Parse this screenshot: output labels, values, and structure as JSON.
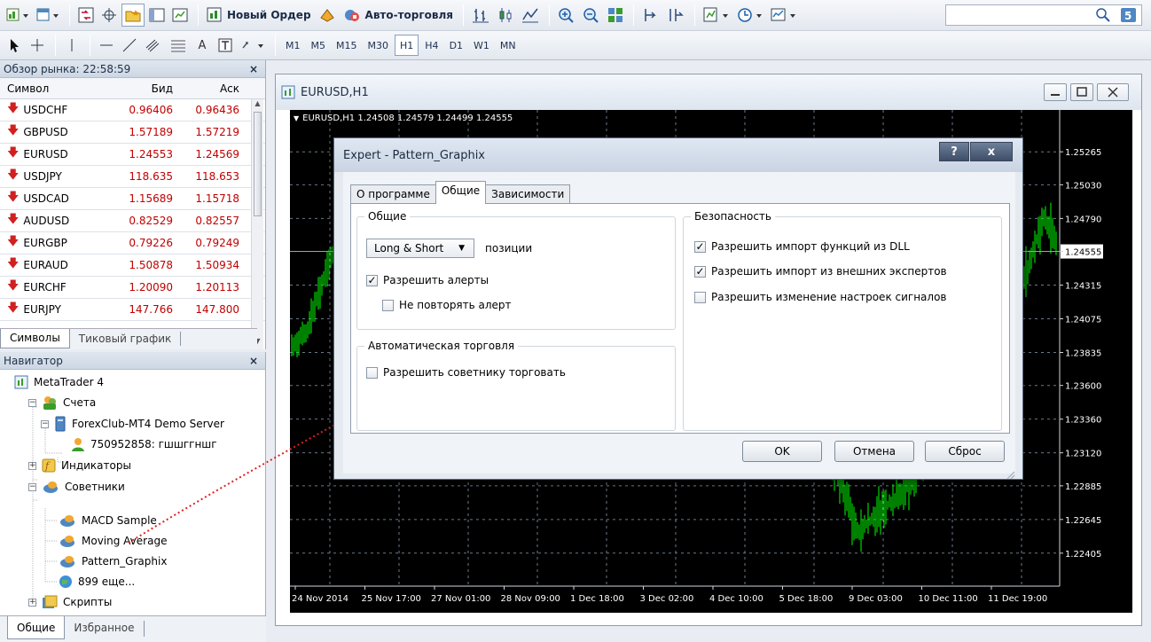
{
  "toolbar": {
    "new_order_label": "Новый Ордер",
    "auto_trading_label": "Авто-торговля",
    "timeframes": [
      "M1",
      "M5",
      "M15",
      "M30",
      "H1",
      "H4",
      "D1",
      "W1",
      "MN"
    ],
    "active_timeframe": "H1",
    "text_tool_label": "A"
  },
  "market_watch": {
    "title": "Обзор рынка: 22:58:59",
    "columns": {
      "symbol": "Символ",
      "bid": "Бид",
      "ask": "Аск"
    },
    "rows": [
      {
        "symbol": "USDCHF",
        "bid": "0.96406",
        "ask": "0.96436"
      },
      {
        "symbol": "GBPUSD",
        "bid": "1.57189",
        "ask": "1.57219"
      },
      {
        "symbol": "EURUSD",
        "bid": "1.24553",
        "ask": "1.24569"
      },
      {
        "symbol": "USDJPY",
        "bid": "118.635",
        "ask": "118.653"
      },
      {
        "symbol": "USDCAD",
        "bid": "1.15689",
        "ask": "1.15718"
      },
      {
        "symbol": "AUDUSD",
        "bid": "0.82529",
        "ask": "0.82557"
      },
      {
        "symbol": "EURGBP",
        "bid": "0.79226",
        "ask": "0.79249"
      },
      {
        "symbol": "EURAUD",
        "bid": "1.50878",
        "ask": "1.50934"
      },
      {
        "symbol": "EURCHF",
        "bid": "1.20090",
        "ask": "1.20113"
      },
      {
        "symbol": "EURJPY",
        "bid": "147.766",
        "ask": "147.800"
      }
    ],
    "tabs": [
      "Символы",
      "Тиковый график"
    ],
    "close": "×"
  },
  "navigator": {
    "title": "Навигатор",
    "close": "×",
    "root": "MetaTrader 4",
    "accounts": "Счета",
    "server": "ForexClub-MT4 Demo Server",
    "account": "750952858: гшшггншг",
    "indicators": "Индикаторы",
    "experts": "Советники",
    "expert_items": [
      "MACD Sample",
      "Moving Average",
      "Pattern_Graphix",
      "899 еще..."
    ],
    "scripts": "Скрипты",
    "tabs": [
      "Общие",
      "Избранное"
    ]
  },
  "chart": {
    "window_title": "EURUSD,H1",
    "info": "EURUSD,H1  1.24508 1.24579 1.24499 1.24555",
    "price_labels": [
      "1.25265",
      "1.25030",
      "1.24790",
      "1.24555",
      "1.24315",
      "1.24075",
      "1.23835",
      "1.23600",
      "1.23360",
      "1.23120",
      "1.22885",
      "1.22645",
      "1.22405"
    ],
    "current_price": "1.24555",
    "time_labels": [
      "24 Nov 2014",
      "25 Nov 17:00",
      "27 Nov 01:00",
      "28 Nov 09:00",
      "1 Dec 18:00",
      "3 Dec 02:00",
      "4 Dec 10:00",
      "5 Dec 18:00",
      "9 Dec 03:00",
      "10 Dec 11:00",
      "11 Dec 19:00"
    ],
    "colors": {
      "background": "#000000",
      "candles": "#00ff00",
      "grid": "#6b7a8a"
    }
  },
  "dialog": {
    "title": "Expert - Pattern_Graphix",
    "help": "?",
    "close": "x",
    "tabs": [
      "О программе",
      "Общие",
      "Зависимости"
    ],
    "active_tab": "Общие",
    "general_group": "Общие",
    "positions_select": "Long & Short",
    "positions_label": "позиции",
    "allow_alerts": "Разрешить алерты",
    "no_repeat_alert": "Не повторять алерт",
    "auto_trading_group": "Автоматическая торговля",
    "allow_expert_trade": "Разрешить советнику торговать",
    "security_group": "Безопасность",
    "allow_dll": "Разрешить импорт функций из DLL",
    "allow_external": "Разрешить импорт из внешних экспертов",
    "allow_signals": "Разрешить изменение настроек сигналов",
    "ok": "OK",
    "cancel": "Отмена",
    "reset": "Сброс"
  }
}
